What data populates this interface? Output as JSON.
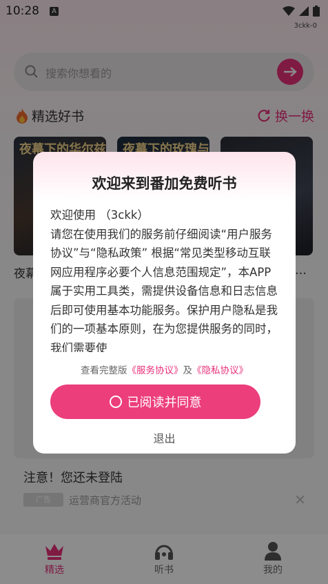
{
  "status": {
    "time": "10:28",
    "tag": "3ckk-0"
  },
  "search": {
    "placeholder": "搜索你想看的"
  },
  "section": {
    "title": "精选好书",
    "swap_label": "换一换"
  },
  "books": [
    {
      "cover_text": "夜幕下的华尔兹",
      "name": "夜幕"
    },
    {
      "cover_text": "夜幕下的玫瑰与利刃",
      "name": ""
    },
    {
      "cover_text": "",
      "name": "…"
    }
  ],
  "notice": {
    "warning": "注意！您还未登陆",
    "ad_badge": "广告",
    "ad_text": "运营商官方活动"
  },
  "nav": {
    "items": [
      {
        "label": "精选"
      },
      {
        "label": "听书"
      },
      {
        "label": "我的"
      }
    ]
  },
  "dialog": {
    "title": "欢迎来到番加免费听书",
    "welcome": "欢迎使用 （3ckk）",
    "body": "请您在使用我们的服务前仔细阅读“用户服务协议”与“隐私政策” 根据“常见类型移动互联网应用程序必要个人信息范围规定”，本APP属于实用工具类，需提供设备信息和日志信息后即可使用基本功能服务。保护用户隐私是我们的一项基本原则，在为您提供服务的同时，我们需要使",
    "links_prefix": "查看完整版",
    "service_link": "《服务协议》",
    "and": "及",
    "privacy_link": "《隐私协议》",
    "agree_label": "已阅读并同意",
    "exit_label": "退出"
  },
  "colors": {
    "accent": "#e8317a",
    "overlay": "rgba(0,0,0,0.45)"
  }
}
